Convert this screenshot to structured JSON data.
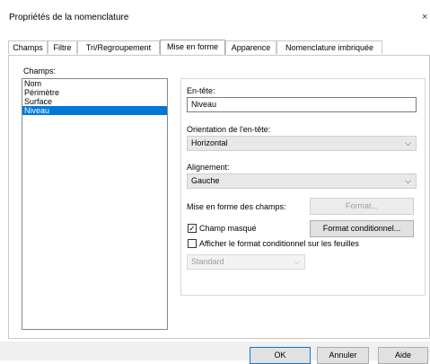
{
  "window": {
    "title": "Propriétés de la nomenclature",
    "close_glyph": "×"
  },
  "tabs": [
    {
      "label": "Champs",
      "active": false
    },
    {
      "label": "Filtre",
      "active": false
    },
    {
      "label": "Tri/Regroupement",
      "active": false
    },
    {
      "label": "Mise en forme",
      "active": true
    },
    {
      "label": "Apparence",
      "active": false
    },
    {
      "label": "Nomenclature imbriquée",
      "active": false
    }
  ],
  "fields": {
    "label": "Champs:",
    "items": [
      "Nom",
      "Périmètre",
      "Surface",
      "Niveau"
    ],
    "selected": "Niveau"
  },
  "format": {
    "header_label": "En-tête:",
    "header_value": "Niveau",
    "orientation_label": "Orientation de l'en-tête:",
    "orientation_value": "Horizontal",
    "alignment_label": "Alignement:",
    "alignment_value": "Gauche",
    "field_format_label": "Mise en forme des champs:",
    "format_button": "Format...",
    "hidden_field_label": "Champ masqué",
    "hidden_field_checked": true,
    "conditional_format_button": "Format conditionnel...",
    "show_conditional_label": "Afficher le format conditionnel sur les feuilles",
    "show_conditional_checked": false,
    "style_value": "Standard"
  },
  "footer": {
    "ok": "OK",
    "cancel": "Annuler",
    "help": "Aide"
  },
  "icons": {
    "chevron": "chevron-down-icon",
    "check": "checkmark-icon"
  }
}
